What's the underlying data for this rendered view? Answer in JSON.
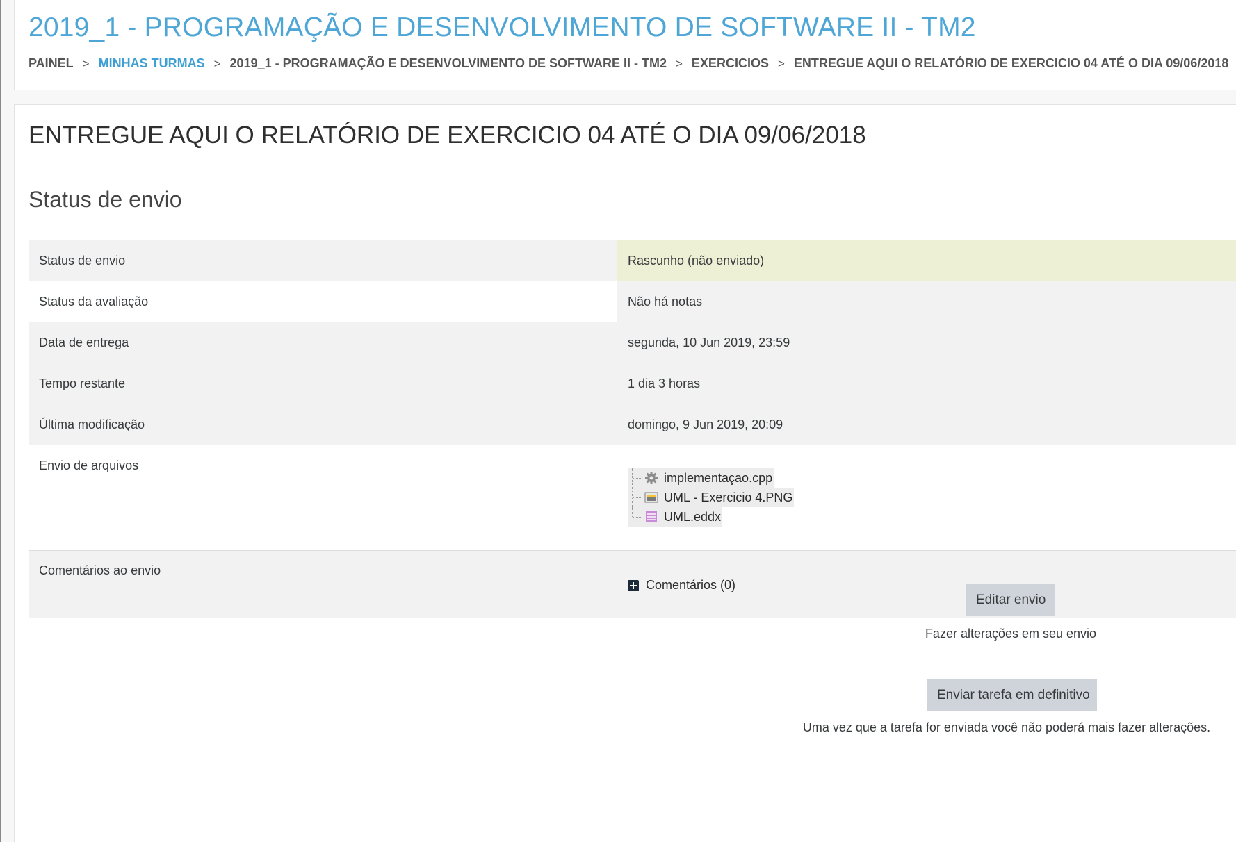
{
  "course": {
    "title": "2019_1 - PROGRAMAÇÃO E DESENVOLVIMENTO DE SOFTWARE II - TM2"
  },
  "breadcrumb": {
    "items": [
      {
        "label": "PAINEL"
      },
      {
        "label": "MINHAS TURMAS"
      },
      {
        "label": "2019_1 - PROGRAMAÇÃO E DESENVOLVIMENTO DE SOFTWARE II - TM2"
      },
      {
        "label": "EXERCICIOS"
      },
      {
        "label": "ENTREGUE AQUI O RELATÓRIO DE EXERCICIO 04 ATÉ O DIA 09/06/2018"
      }
    ],
    "separator": ">"
  },
  "assignment": {
    "title": "ENTREGUE AQUI O RELATÓRIO DE EXERCICIO 04 ATÉ O DIA 09/06/2018"
  },
  "submission_status": {
    "heading": "Status de envio",
    "rows": {
      "status": {
        "label": "Status de envio",
        "value": "Rascunho (não enviado)"
      },
      "grading": {
        "label": "Status da avaliação",
        "value": "Não há notas"
      },
      "due": {
        "label": "Data de entrega",
        "value": "segunda, 10 Jun 2019, 23:59"
      },
      "remaining": {
        "label": "Tempo restante",
        "value": "1 dia 3 horas"
      },
      "modified": {
        "label": "Última modificação",
        "value": "domingo, 9 Jun 2019, 20:09"
      },
      "files": {
        "label": "Envio de arquivos",
        "items": [
          {
            "name": "implementaçao.cpp",
            "icon": "gear-file-icon"
          },
          {
            "name": "UML - Exercicio 4.PNG",
            "icon": "image-file-icon"
          },
          {
            "name": "UML.eddx",
            "icon": "archive-file-icon"
          }
        ]
      },
      "comments": {
        "label": "Comentários ao envio",
        "link": "Comentários (0)"
      }
    }
  },
  "actions": {
    "edit_button": "Editar envio",
    "edit_hint": "Fazer alterações em seu envio",
    "submit_button": "Enviar tarefa em definitivo",
    "submit_hint": "Uma vez que a tarefa for enviada você não poderá mais fazer alterações."
  },
  "colors": {
    "title_blue": "#4da6d6",
    "link_blue": "#3e9fd3",
    "draft_highlight": "#eef0d6",
    "button_grey": "#ced4da"
  }
}
